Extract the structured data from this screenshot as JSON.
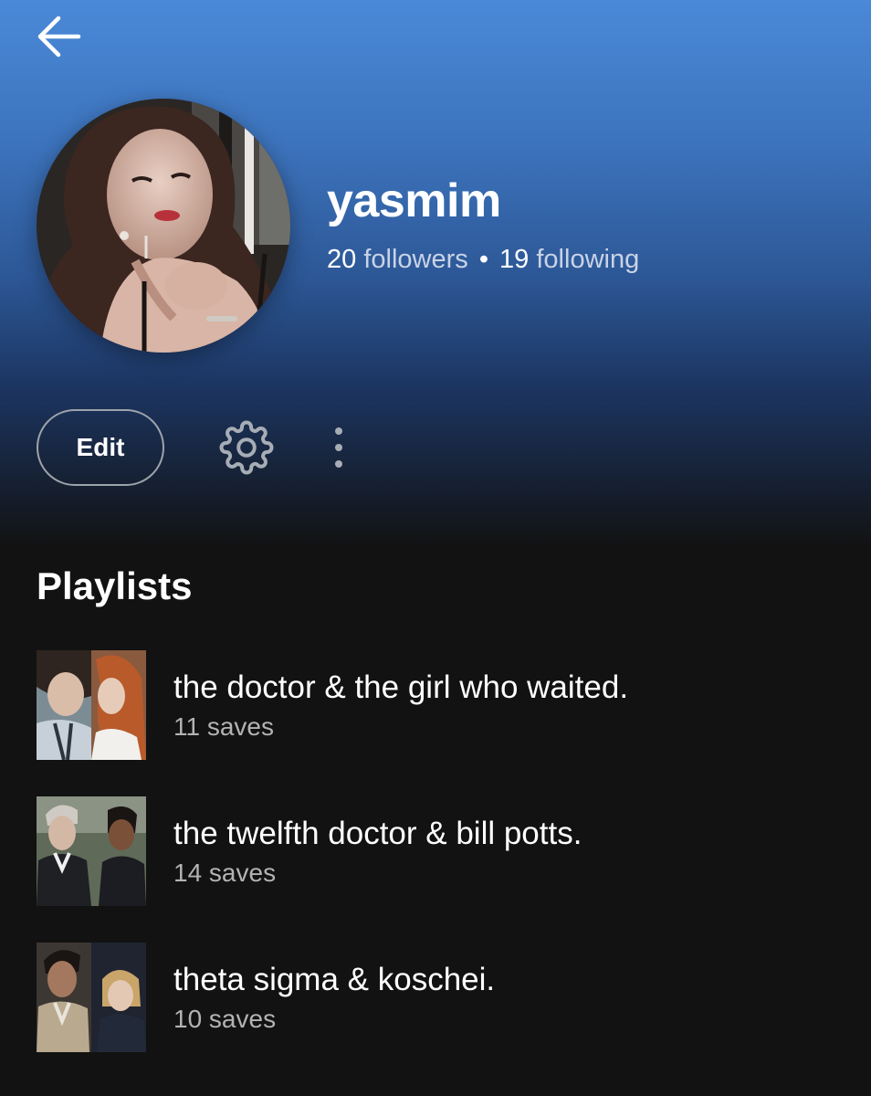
{
  "header": {
    "back_icon": "arrow-left-icon"
  },
  "profile": {
    "name": "yasmim",
    "avatar_alt": "profile photo",
    "followers_count": "20",
    "followers_label": "followers",
    "separator": "•",
    "following_count": "19",
    "following_label": "following"
  },
  "actions": {
    "edit_label": "Edit",
    "settings_icon": "gear-icon",
    "more_icon": "more-vertical-icon"
  },
  "playlists": {
    "title": "Playlists",
    "items": [
      {
        "title": "the doctor & the girl who waited.",
        "saves": "11 saves"
      },
      {
        "title": "the twelfth doctor & bill potts.",
        "saves": "14 saves"
      },
      {
        "title": "theta sigma & koschei.",
        "saves": "10 saves"
      }
    ]
  },
  "colors": {
    "gradient_top": "#4a89d8",
    "background": "#121212",
    "text_primary": "#ffffff",
    "text_secondary": "#b3b3b3"
  }
}
